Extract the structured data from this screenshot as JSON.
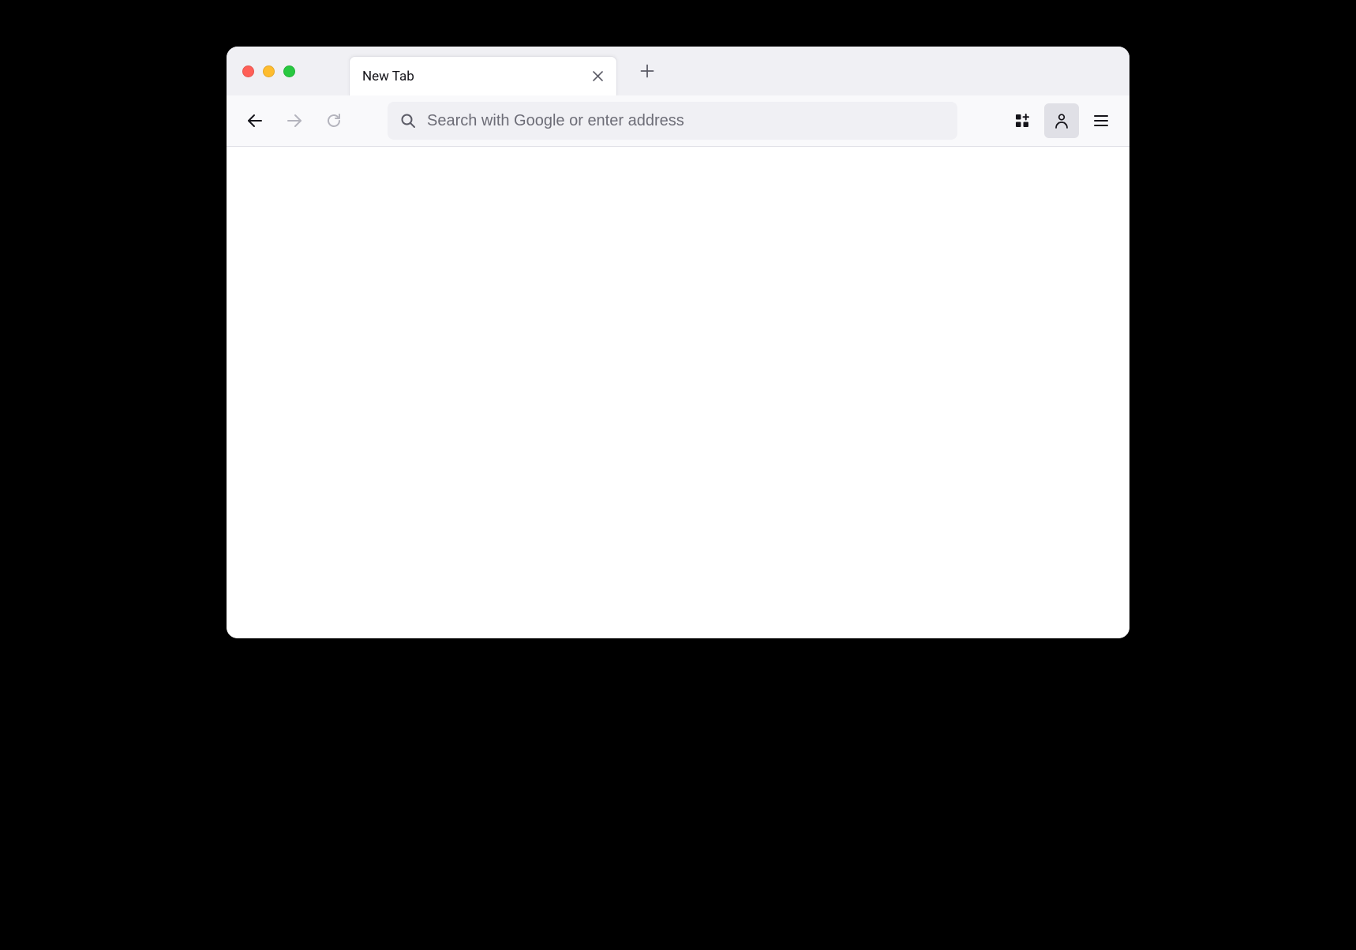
{
  "window": {
    "traffic_lights": {
      "close_color": "#ff5f57",
      "minimize_color": "#febc2e",
      "maximize_color": "#28c840"
    }
  },
  "tabs": [
    {
      "title": "New Tab",
      "active": true
    }
  ],
  "toolbar": {
    "back_enabled": true,
    "forward_enabled": false,
    "reload_enabled": false
  },
  "address_bar": {
    "placeholder": "Search with Google or enter address",
    "value": ""
  },
  "right_toolbar": {
    "extensions_icon": "apps-grid-icon",
    "account_icon": "firefox-account-icon",
    "menu_icon": "hamburger-menu-icon"
  }
}
